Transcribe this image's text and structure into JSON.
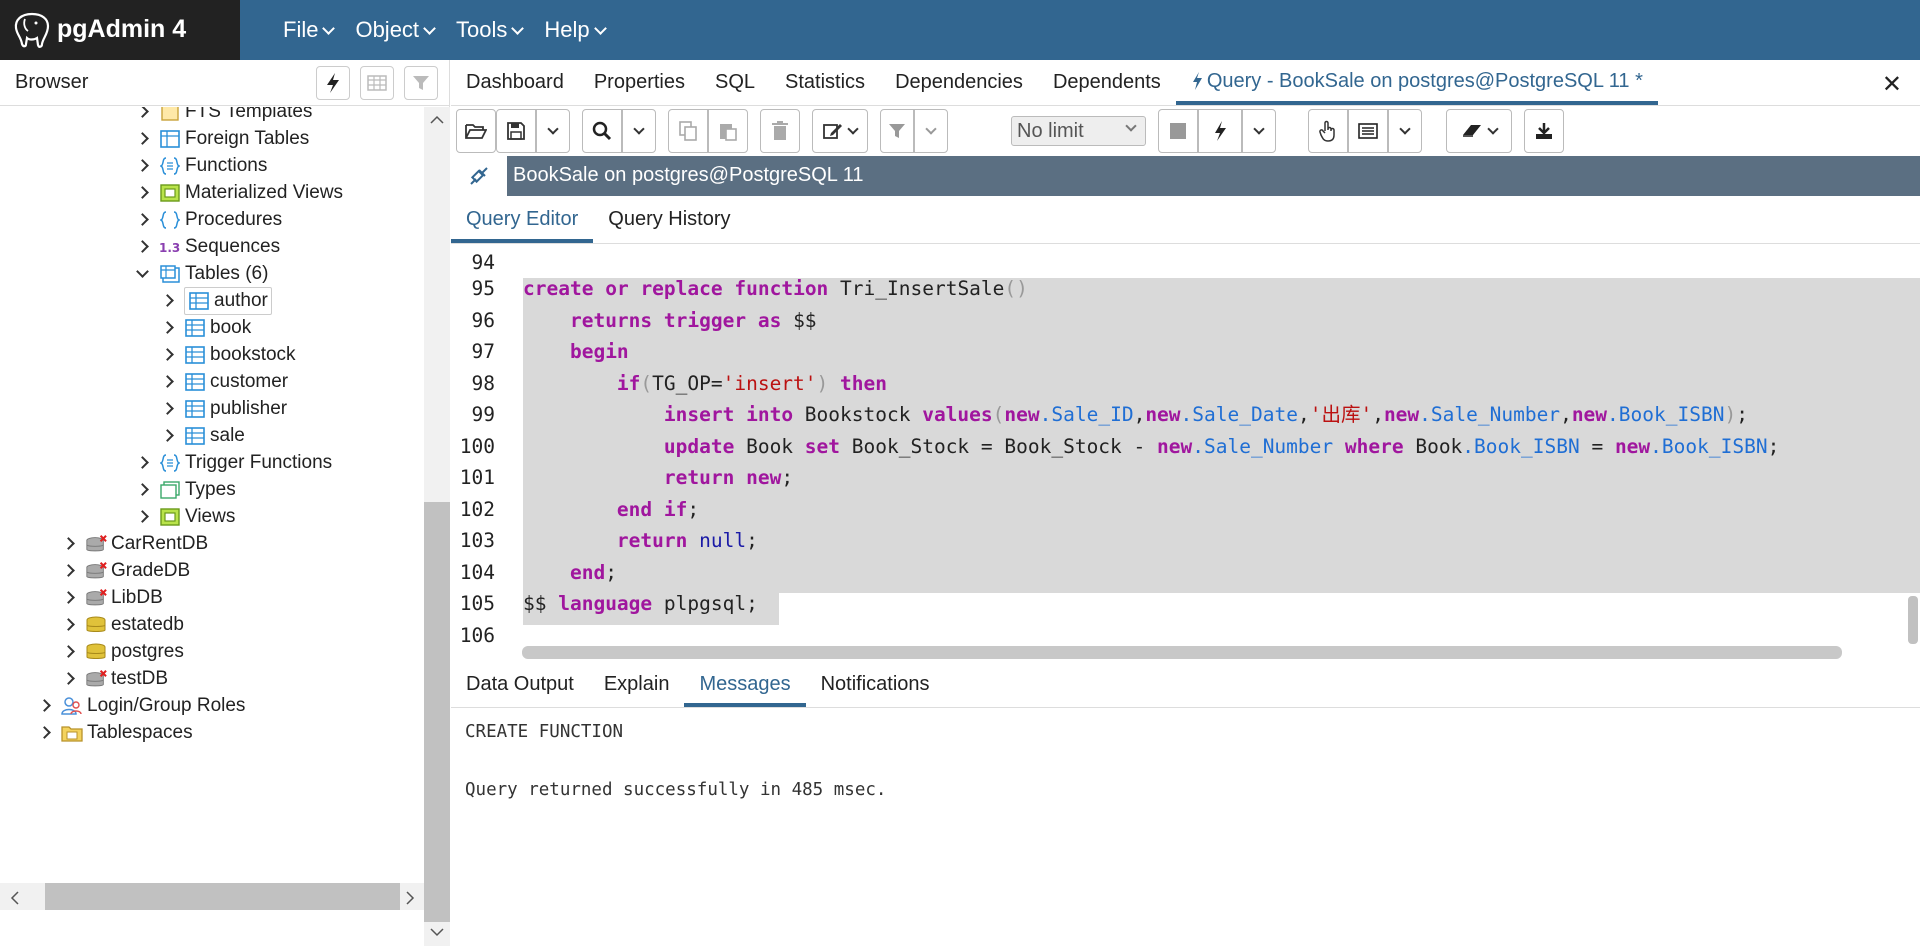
{
  "app": {
    "title": "pgAdmin 4"
  },
  "menu": [
    {
      "label": "File"
    },
    {
      "label": "Object"
    },
    {
      "label": "Tools"
    },
    {
      "label": "Help"
    }
  ],
  "browser": {
    "title": "Browser",
    "tree": [
      {
        "label": "FTS Templates",
        "depth": 2,
        "icon": "fts-templates-icon",
        "expanded": false
      },
      {
        "label": "Foreign Tables",
        "depth": 2,
        "icon": "foreign-table-icon",
        "expanded": false
      },
      {
        "label": "Functions",
        "depth": 2,
        "icon": "function-icon",
        "expanded": false
      },
      {
        "label": "Materialized Views",
        "depth": 2,
        "icon": "materialized-view-icon",
        "expanded": false
      },
      {
        "label": "Procedures",
        "depth": 2,
        "icon": "procedure-icon",
        "expanded": false
      },
      {
        "label": "Sequences",
        "depth": 2,
        "icon": "sequence-icon",
        "expanded": false
      },
      {
        "label": "Tables (6)",
        "depth": 2,
        "icon": "tables-icon",
        "expanded": true
      },
      {
        "label": "author",
        "depth": 3,
        "icon": "table-icon",
        "expanded": false,
        "selected": true
      },
      {
        "label": "book",
        "depth": 3,
        "icon": "table-icon",
        "expanded": false
      },
      {
        "label": "bookstock",
        "depth": 3,
        "icon": "table-icon",
        "expanded": false
      },
      {
        "label": "customer",
        "depth": 3,
        "icon": "table-icon",
        "expanded": false
      },
      {
        "label": "publisher",
        "depth": 3,
        "icon": "table-icon",
        "expanded": false
      },
      {
        "label": "sale",
        "depth": 3,
        "icon": "table-icon",
        "expanded": false
      },
      {
        "label": "Trigger Functions",
        "depth": 2,
        "icon": "trigger-function-icon",
        "expanded": false
      },
      {
        "label": "Types",
        "depth": 2,
        "icon": "type-icon",
        "expanded": false
      },
      {
        "label": "Views",
        "depth": 2,
        "icon": "view-icon",
        "expanded": false
      },
      {
        "label": "CarRentDB",
        "depth": 1,
        "icon": "database-disconnected-icon",
        "expanded": false
      },
      {
        "label": "GradeDB",
        "depth": 1,
        "icon": "database-disconnected-icon",
        "expanded": false
      },
      {
        "label": "LibDB",
        "depth": 1,
        "icon": "database-disconnected-icon",
        "expanded": false
      },
      {
        "label": "estatedb",
        "depth": 1,
        "icon": "database-icon",
        "expanded": false
      },
      {
        "label": "postgres",
        "depth": 1,
        "icon": "database-icon",
        "expanded": false
      },
      {
        "label": "testDB",
        "depth": 1,
        "icon": "database-disconnected-icon",
        "expanded": false
      },
      {
        "label": "Login/Group Roles",
        "depth": 0,
        "icon": "login-roles-icon",
        "expanded": false
      },
      {
        "label": "Tablespaces",
        "depth": 0,
        "icon": "tablespace-icon",
        "expanded": false
      }
    ]
  },
  "tabs": [
    {
      "label": "Dashboard"
    },
    {
      "label": "Properties"
    },
    {
      "label": "SQL"
    },
    {
      "label": "Statistics"
    },
    {
      "label": "Dependencies"
    },
    {
      "label": "Dependents"
    },
    {
      "label": "Query - BookSale on postgres@PostgreSQL 11 *",
      "active": true
    }
  ],
  "toolbar": {
    "limit": "No limit"
  },
  "connection": {
    "label": "BookSale on postgres@PostgreSQL 11"
  },
  "query_tabs": [
    {
      "label": "Query Editor",
      "active": true
    },
    {
      "label": "Query History"
    }
  ],
  "editor": {
    "line_numbers": [
      "94",
      "95",
      "96",
      "97",
      "98",
      "99",
      "100",
      "101",
      "102",
      "103",
      "104",
      "105",
      "106"
    ]
  },
  "output_tabs": [
    {
      "label": "Data Output"
    },
    {
      "label": "Explain"
    },
    {
      "label": "Messages",
      "active": true
    },
    {
      "label": "Notifications"
    }
  ],
  "messages": {
    "line1": "CREATE FUNCTION",
    "line2": "Query returned successfully in 485 msec."
  },
  "colors": {
    "navbar": "#326690",
    "brand_bg": "#222222",
    "accent": "#326690",
    "keyword": "#a0169e",
    "field": "#1f6ed4",
    "string": "#bb1111"
  }
}
